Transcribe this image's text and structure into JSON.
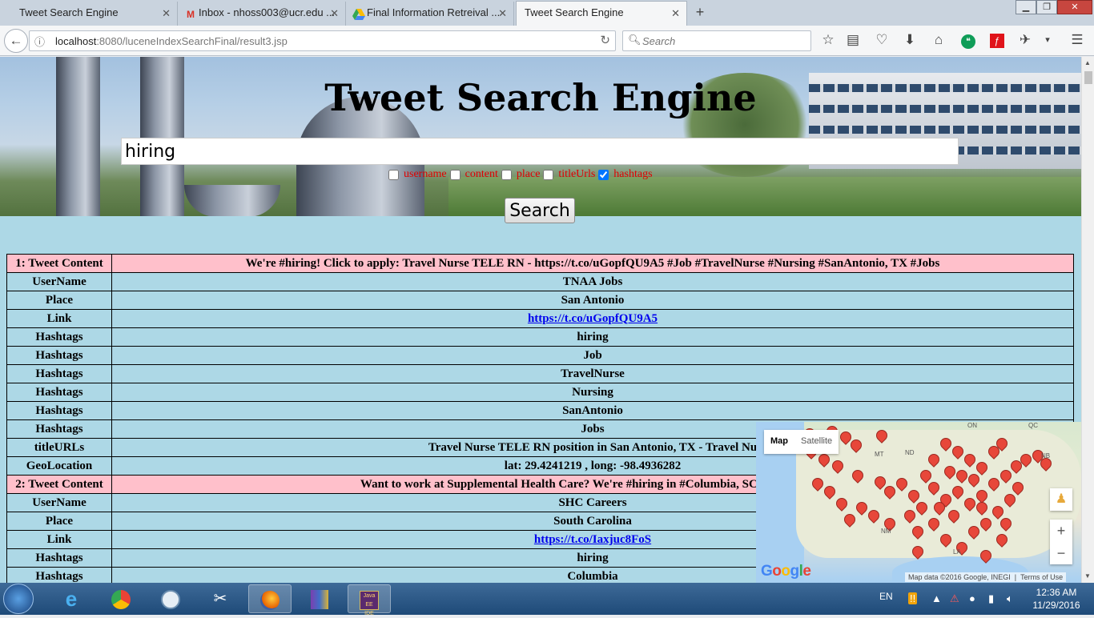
{
  "browser": {
    "tabs": [
      {
        "title": "Tweet Search Engine",
        "icon": "page-icon",
        "active": false
      },
      {
        "title": "Inbox - nhoss003@ucr.edu ...",
        "icon": "gmail-icon",
        "active": false
      },
      {
        "title": "Final Information Retreival ...",
        "icon": "google-drive-icon",
        "active": false
      },
      {
        "title": "Tweet Search Engine",
        "icon": "page-icon",
        "active": true
      }
    ],
    "url_host": "localhost",
    "url_rest": ":8080/luceneIndexSearchFinal/result3.jsp",
    "search_placeholder": "Search"
  },
  "page": {
    "title": "Tweet Search Engine",
    "query": "hiring",
    "options": [
      {
        "label": "username",
        "checked": false
      },
      {
        "label": "content",
        "checked": false
      },
      {
        "label": "place",
        "checked": false
      },
      {
        "label": "titleUrls",
        "checked": false
      },
      {
        "label": "hashtags",
        "checked": true
      }
    ],
    "search_button": "Search"
  },
  "results": [
    {
      "key": "1: Tweet Content",
      "value": "We're #hiring! Click to apply: Travel Nurse TELE RN - https://t.co/uGopfQU9A5 #Job #TravelNurse #Nursing #SanAntonio, TX #Jobs",
      "head": true
    },
    {
      "key": "UserName",
      "value": "TNAA Jobs"
    },
    {
      "key": "Place",
      "value": "San Antonio"
    },
    {
      "key": "Link",
      "value": "https://t.co/uGopfQU9A5",
      "link": true
    },
    {
      "key": "Hashtags",
      "value": "hiring"
    },
    {
      "key": "Hashtags",
      "value": "Job"
    },
    {
      "key": "Hashtags",
      "value": "TravelNurse"
    },
    {
      "key": "Hashtags",
      "value": "Nursing"
    },
    {
      "key": "Hashtags",
      "value": "SanAntonio"
    },
    {
      "key": "Hashtags",
      "value": "Jobs"
    },
    {
      "key": "titleURLs",
      "value": "Travel Nurse TELE RN position in San Antonio, TX - Travel Nu"
    },
    {
      "key": "GeoLocation",
      "value": "lat: 29.4241219 , long: -98.4936282"
    },
    {
      "key": "2: Tweet Content",
      "value": "Want to work at Supplemental Health Care? We're #hiring in #Columbia, SC! Click for de",
      "head": true
    },
    {
      "key": "UserName",
      "value": "SHC Careers"
    },
    {
      "key": "Place",
      "value": "South Carolina"
    },
    {
      "key": "Link",
      "value": "https://t.co/Iaxjuc8FoS",
      "link": true
    },
    {
      "key": "Hashtags",
      "value": "hiring"
    },
    {
      "key": "Hashtags",
      "value": "Columbia"
    }
  ],
  "map": {
    "map_label": "Map",
    "satellite_label": "Satellite",
    "attribution": "Map data ©2016 Google, INEGI",
    "terms": "Terms of Use",
    "logo": "Google",
    "labels": [
      "ON",
      "QC",
      "MT",
      "ND",
      "NB",
      "NM",
      "LA"
    ]
  },
  "taskbar": {
    "apps": [
      "start-orb",
      "internet-explorer-icon",
      "chrome-icon",
      "safari-icon",
      "snipping-tool-icon",
      "firefox-icon",
      "winrar-icon",
      "eclipse-javaee-icon"
    ],
    "language": "EN",
    "time": "12:36 AM",
    "date": "11/29/2016"
  },
  "colors": {
    "page_bg": "#add8e6",
    "row_head_bg": "#ffc0cb",
    "option_text": "#e00000",
    "link": "#0000ee",
    "pin": "#e7473a"
  }
}
